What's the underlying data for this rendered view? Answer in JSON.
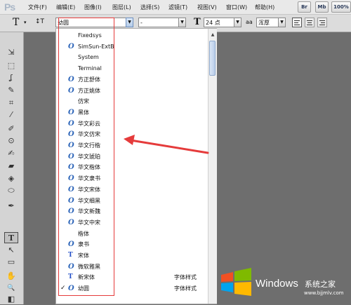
{
  "app": {
    "logo": "Ps"
  },
  "menu": {
    "items": [
      "文件(F)",
      "编辑(E)",
      "图像(I)",
      "图层(L)",
      "选择(S)",
      "滤镜(T)",
      "视图(V)",
      "窗口(W)",
      "帮助(H)"
    ],
    "buttons": [
      "Br",
      "Mb",
      "100%"
    ]
  },
  "options": {
    "tool_glyph": "T",
    "orient_glyph": "↕T",
    "font_family": "幼圆",
    "font_style": "-",
    "size_glyph": "T",
    "font_size": "24 点",
    "aa_glyph": "aa",
    "antialias": "浑厚"
  },
  "font_list": {
    "rows": [
      {
        "name": "Fixedsys",
        "icon": "",
        "sample": "",
        "checked": false
      },
      {
        "name": "SimSun-ExtB",
        "icon": "O",
        "sample": "",
        "checked": false
      },
      {
        "name": "System",
        "icon": "",
        "sample": "",
        "checked": false
      },
      {
        "name": "Terminal",
        "icon": "",
        "sample": "",
        "checked": false
      },
      {
        "name": "方正舒体",
        "icon": "O",
        "sample": "",
        "checked": false
      },
      {
        "name": "方正姚体",
        "icon": "O",
        "sample": "",
        "checked": false
      },
      {
        "name": "仿宋",
        "icon": "",
        "sample": "",
        "checked": false
      },
      {
        "name": "黑体",
        "icon": "O",
        "sample": "",
        "checked": false
      },
      {
        "name": "华文彩云",
        "icon": "O",
        "sample": "",
        "checked": false
      },
      {
        "name": "华文仿宋",
        "icon": "O",
        "sample": "",
        "checked": false
      },
      {
        "name": "华文行楷",
        "icon": "O",
        "sample": "",
        "checked": false
      },
      {
        "name": "华文琥珀",
        "icon": "O",
        "sample": "",
        "checked": false
      },
      {
        "name": "华文楷体",
        "icon": "O",
        "sample": "",
        "checked": false
      },
      {
        "name": "华文隶书",
        "icon": "O",
        "sample": "",
        "checked": false
      },
      {
        "name": "华文宋体",
        "icon": "O",
        "sample": "",
        "checked": false
      },
      {
        "name": "华文细黑",
        "icon": "O",
        "sample": "",
        "checked": false
      },
      {
        "name": "华文新魏",
        "icon": "O",
        "sample": "",
        "checked": false
      },
      {
        "name": "华文中宋",
        "icon": "O",
        "sample": "",
        "checked": false
      },
      {
        "name": "楷体",
        "icon": "",
        "sample": "",
        "checked": false
      },
      {
        "name": "隶书",
        "icon": "O",
        "sample": "",
        "checked": false
      },
      {
        "name": "宋体",
        "icon": "TT",
        "sample": "",
        "checked": false
      },
      {
        "name": "微软雅黑",
        "icon": "O",
        "sample": "",
        "checked": false
      },
      {
        "name": "新宋体",
        "icon": "TT",
        "sample": "字体样式",
        "checked": false
      },
      {
        "name": "幼圆",
        "icon": "O",
        "sample": "字体样式",
        "checked": true
      }
    ]
  },
  "tools": [
    "⇲",
    "⬚",
    "ʆ",
    "✎",
    "⌗",
    "⁄",
    "✐",
    "⊙",
    "✍",
    "▰",
    "◈",
    "⬭",
    "✒",
    "T",
    "↖",
    "▭",
    "✋",
    "🔍",
    "◧",
    "⇆"
  ],
  "watermark": {
    "title": "Windows",
    "subtitle": "系统之家",
    "url": "www.bjjmlv.com"
  },
  "colors": {
    "annotation_red": "#e53b3b",
    "selected_list_bg": "#ffffff",
    "accent_blue": "#2a63b8"
  }
}
